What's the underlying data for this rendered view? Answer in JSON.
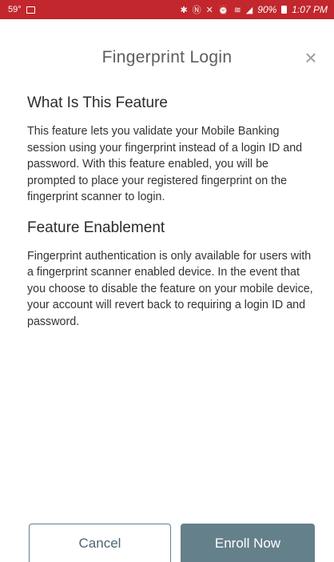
{
  "status_bar": {
    "temperature": "59°",
    "battery": "90%",
    "time": "1:07 PM",
    "background_color": "#c1272d"
  },
  "header": {
    "title": "Fingerprint Login",
    "close_icon": "×"
  },
  "sections": [
    {
      "heading": "What Is This Feature",
      "body": "This feature lets you validate your Mobile Banking session using your fingerprint instead of a login ID and password. With this feature enabled, you will be prompted to place your registered fingerprint on the fingerprint scanner to login."
    },
    {
      "heading": "Feature Enablement",
      "body": "Fingerprint authentication is only available for users with a fingerprint scanner enabled device. In the event that you choose to disable the feature on your mobile device, your account will revert back to requiring a login ID and password."
    }
  ],
  "buttons": {
    "cancel": "Cancel",
    "enroll": "Enroll Now",
    "enroll_color": "#64808b"
  }
}
